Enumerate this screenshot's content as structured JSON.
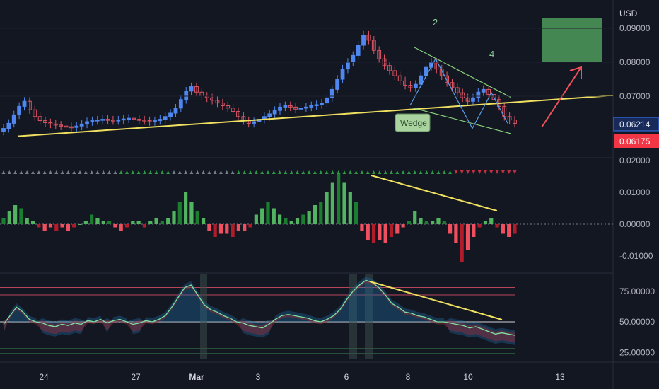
{
  "chart_data": [
    {
      "type": "candlestick",
      "currency_label": "USD",
      "y_ticks": [
        "0.09000",
        "0.08000",
        "0.07000"
      ],
      "last_price_label": "0.06214",
      "second_price_label": "0.06175",
      "x_tick_labels": [
        "24",
        "27",
        "Mar",
        "3",
        "6",
        "8",
        "10",
        "13"
      ],
      "annotations": [
        "2",
        "4",
        "Wedge"
      ],
      "trendline_y": [
        0.0582,
        0.0702
      ],
      "wedge_upper_y": [
        0.0845,
        0.0697
      ],
      "wedge_lower_y": [
        0.0665,
        0.059
      ],
      "target_box_y": [
        0.08,
        0.093
      ],
      "closes": [
        0.0605,
        0.062,
        0.0645,
        0.067,
        0.0685,
        0.066,
        0.064,
        0.0628,
        0.0622,
        0.0618,
        0.0615,
        0.0612,
        0.061,
        0.0608,
        0.0612,
        0.0618,
        0.0625,
        0.0628,
        0.063,
        0.0632,
        0.063,
        0.0628,
        0.063,
        0.0633,
        0.0635,
        0.0632,
        0.063,
        0.0628,
        0.0625,
        0.0628,
        0.0632,
        0.064,
        0.065,
        0.0665,
        0.069,
        0.0715,
        0.0728,
        0.0712,
        0.07,
        0.0695,
        0.0688,
        0.068,
        0.0672,
        0.0665,
        0.0655,
        0.064,
        0.0628,
        0.062,
        0.0625,
        0.0632,
        0.064,
        0.0648,
        0.0658,
        0.0668,
        0.0672,
        0.0668,
        0.0662,
        0.0665,
        0.0668,
        0.0672,
        0.0675,
        0.068,
        0.0695,
        0.072,
        0.075,
        0.078,
        0.08,
        0.082,
        0.085,
        0.088,
        0.0865,
        0.0835,
        0.081,
        0.079,
        0.0775,
        0.076,
        0.0745,
        0.0732,
        0.0725,
        0.0735,
        0.076,
        0.0785,
        0.08,
        0.078,
        0.076,
        0.074,
        0.0725,
        0.071,
        0.0695,
        0.0685,
        0.0695,
        0.0712,
        0.072,
        0.0705,
        0.069,
        0.067,
        0.064,
        0.063,
        0.062
      ],
      "osc_ticks": [
        "0.02000",
        "0.01000",
        "0.00000",
        "-0.01000"
      ],
      "osc_values": [
        0.002,
        0.004,
        0.006,
        0.005,
        0.002,
        0.001,
        -0.001,
        -0.002,
        -0.001,
        -0.002,
        -0.001,
        -0.002,
        -0.001,
        0.0,
        0.001,
        0.003,
        0.002,
        0.001,
        0.001,
        -0.001,
        -0.002,
        -0.001,
        0.001,
        0.001,
        -0.001,
        0.001,
        0.002,
        0.001,
        0.002,
        0.004,
        0.007,
        0.01,
        0.007,
        0.004,
        0.002,
        -0.002,
        -0.004,
        -0.003,
        -0.003,
        -0.004,
        -0.002,
        -0.002,
        -0.001,
        0.003,
        0.005,
        0.007,
        0.005,
        0.003,
        0.002,
        0.001,
        0.002,
        0.003,
        0.004,
        0.006,
        0.007,
        0.01,
        0.013,
        0.016,
        0.013,
        0.01,
        0.007,
        -0.002,
        -0.005,
        -0.006,
        -0.005,
        -0.006,
        -0.004,
        -0.003,
        -0.001,
        0.001,
        0.004,
        0.002,
        0.001,
        0.001,
        0.002,
        0.001,
        -0.003,
        -0.006,
        -0.012,
        -0.008,
        -0.004,
        -0.001,
        0.001,
        0.002,
        -0.001,
        -0.003,
        -0.004,
        -0.003
      ],
      "rsi_ticks": [
        "75.00000",
        "50.00000",
        "25.00000"
      ],
      "rsi_values": [
        48,
        55,
        62,
        58,
        52,
        50,
        49,
        47,
        46,
        48,
        47,
        49,
        48,
        51,
        50,
        52,
        49,
        51,
        52,
        50,
        48,
        49,
        51,
        50,
        52,
        55,
        62,
        70,
        78,
        80,
        72,
        64,
        60,
        58,
        55,
        53,
        50,
        49,
        47,
        46,
        45,
        48,
        52,
        55,
        56,
        55,
        54,
        53,
        51,
        50,
        52,
        55,
        60,
        68,
        75,
        80,
        84,
        82,
        78,
        72,
        65,
        62,
        58,
        57,
        55,
        54,
        52,
        50,
        50,
        49,
        48,
        47,
        45,
        46,
        44,
        42,
        40,
        41,
        40,
        39
      ]
    }
  ]
}
